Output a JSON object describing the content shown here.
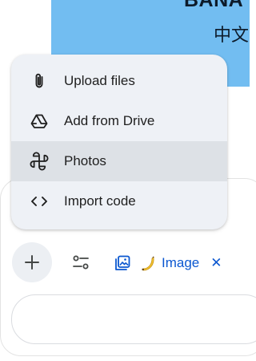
{
  "banner": {
    "title": "BANA",
    "subtitle": "中文"
  },
  "menu": {
    "items": [
      {
        "label": "Upload files",
        "icon": "paperclip-icon",
        "active": false
      },
      {
        "label": "Add from Drive",
        "icon": "drive-icon",
        "active": false
      },
      {
        "label": "Photos",
        "icon": "photos-pinwheel-icon",
        "active": true
      },
      {
        "label": "Import code",
        "icon": "code-icon",
        "active": false
      }
    ]
  },
  "toolbar": {
    "plus_icon": "plus-icon",
    "tools_icon": "tools-sliders-icon",
    "chip": {
      "icon": "image-gallery-icon",
      "emoji": "banana",
      "label": "Image",
      "close_glyph": "✕"
    }
  },
  "input": {
    "placeholder": ""
  },
  "colors": {
    "banner_bg": "#72bdf1",
    "accent": "#0b57d0",
    "menu_bg": "#eef1f6",
    "menu_active": "#dde1e6"
  }
}
